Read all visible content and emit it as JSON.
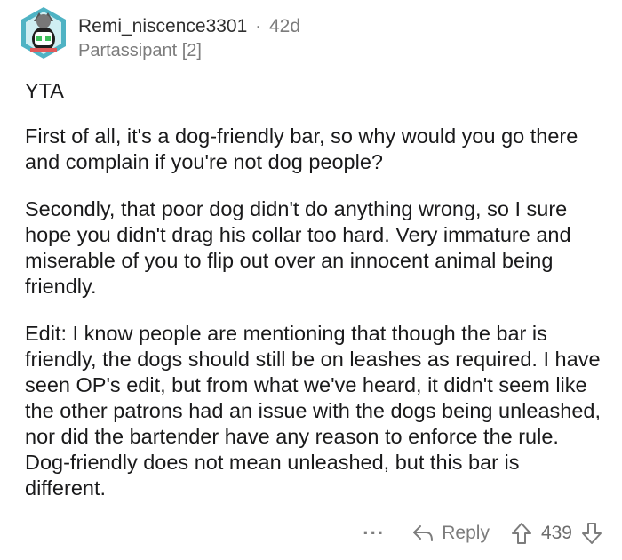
{
  "comment": {
    "username": "Remi_niscence3301",
    "separator": "·",
    "age": "42d",
    "flair": "Partassipant [2]",
    "paragraphs": [
      "YTA",
      "First of all, it's a dog-friendly bar, so why would you go there and complain if you're not dog people?",
      "Secondly, that poor dog didn't do anything wrong, so I sure hope you didn't drag his collar too hard. Very immature and miserable of you to flip out over an innocent animal being friendly.",
      "Edit: I know people are mentioning that though the bar is friendly, the dogs should still be on leashes as required. I have seen OP's edit, but from what we've heard, it didn't seem like the other patrons had an issue with the dogs being unleashed, nor did the bartender have any reason to enforce the rule. Dog-friendly does not mean unleashed, but this bar is different."
    ]
  },
  "actions": {
    "more": "···",
    "reply_label": "Reply",
    "vote_count": "439"
  },
  "icons": {
    "avatar": "avatar-icon",
    "reply": "reply-arrow-icon",
    "upvote": "upvote-arrow-icon",
    "downvote": "downvote-arrow-icon"
  },
  "colors": {
    "text": "#1a1a1b",
    "meta": "#7c7c7c",
    "avatar_bg": "#4fb3c4"
  }
}
